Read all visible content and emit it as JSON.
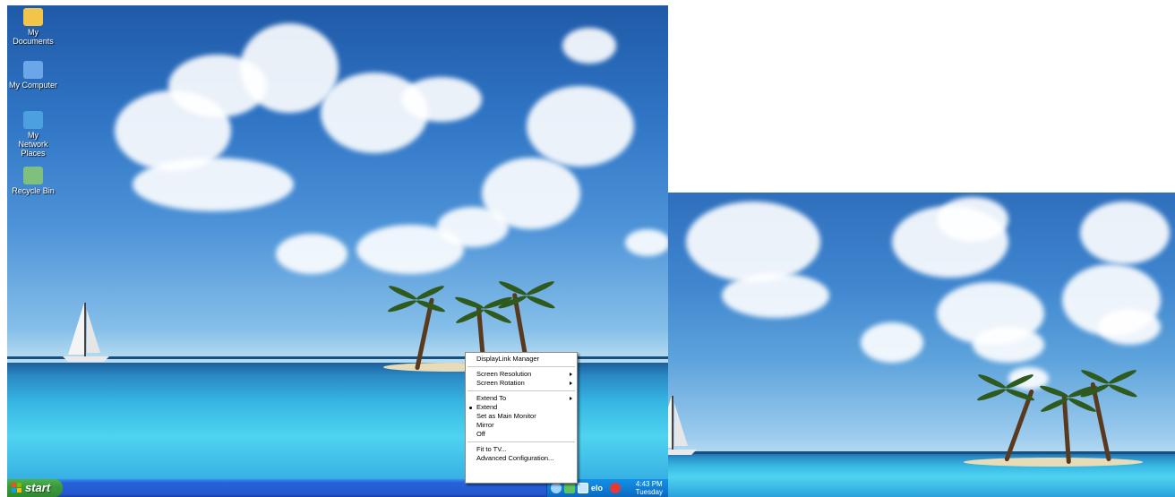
{
  "desktop_icons": [
    {
      "label": "My Documents",
      "icon": "my-documents-icon",
      "color": "#f2c44a"
    },
    {
      "label": "My Computer",
      "icon": "my-computer-icon",
      "color": "#6aa6e8"
    },
    {
      "label": "My Network Places",
      "icon": "network-places-icon",
      "color": "#4da0e0"
    },
    {
      "label": "Recycle Bin",
      "icon": "recycle-bin-icon",
      "color": "#7fc07f"
    }
  ],
  "taskbar": {
    "start_label": "start",
    "clock_time": "4:43 PM",
    "clock_day": "Tuesday",
    "tray_icons": [
      "network-icon",
      "update-icon",
      "displaylink-icon",
      "elo-icon",
      "security-icon"
    ],
    "colors": {
      "taskbar": "#2458d2",
      "start": "#3c9a3c",
      "tray": "#0f7fd6"
    }
  },
  "context_menu": {
    "title": "DisplayLink Manager",
    "group1": [
      {
        "label": "Screen Resolution",
        "submenu": true
      },
      {
        "label": "Screen Rotation",
        "submenu": true
      }
    ],
    "group2": [
      {
        "label": "Extend To",
        "submenu": true
      },
      {
        "label": "Extend",
        "selected": true
      },
      {
        "label": "Set as Main Monitor"
      },
      {
        "label": "Mirror"
      },
      {
        "label": "Off"
      }
    ],
    "group3": [
      {
        "label": "Fit to TV..."
      },
      {
        "label": "Advanced Configuration..."
      }
    ]
  }
}
